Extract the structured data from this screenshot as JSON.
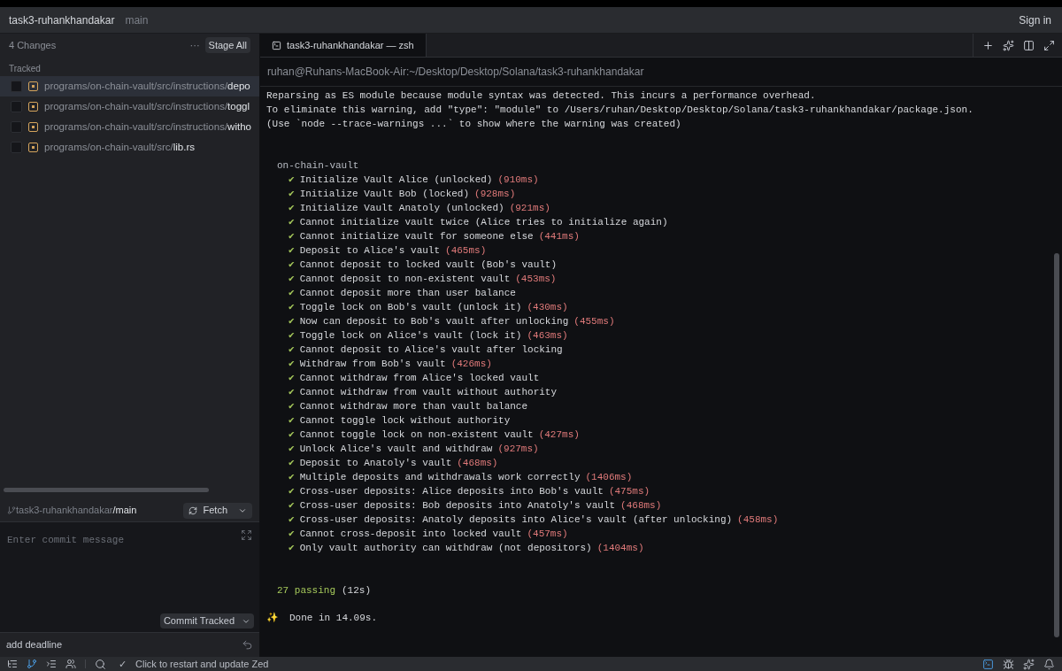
{
  "titlebar": {
    "project": "task3-ruhankhandakar",
    "branch": "main",
    "sign_in": "Sign in"
  },
  "git_panel": {
    "changes": "4 Changes",
    "more": "···",
    "stage_all": "Stage All",
    "section": "Tracked",
    "files": [
      {
        "dir": "programs/on-chain-vault/src/instructions/",
        "name": "depo",
        "checked": false,
        "selected": true
      },
      {
        "dir": "programs/on-chain-vault/src/instructions/",
        "name": "toggl",
        "checked": false,
        "selected": false
      },
      {
        "dir": "programs/on-chain-vault/src/instructions/",
        "name": "witho",
        "checked": false,
        "selected": false
      },
      {
        "dir": "programs/on-chain-vault/src/",
        "name": "lib.rs",
        "checked": false,
        "selected": false
      }
    ],
    "repo": "task3-ruhankhandakar",
    "repo_branch": "/main",
    "fetch": "Fetch",
    "commit_placeholder": "Enter commit message",
    "commit": "Commit Tracked",
    "last_commit": "add deadline"
  },
  "terminal": {
    "tab": "task3-ruhankhandakar — zsh",
    "path": "ruhan@Ruhans-MacBook-Air:~/Desktop/Desktop/Solana/task3-ruhankhandakar",
    "warnings": [
      "Reparsing as ES module because module syntax was detected. This incurs a performance overhead.",
      "To eliminate this warning, add \"type\": \"module\" to /Users/ruhan/Desktop/Desktop/Solana/task3-ruhankhandakar/package.json.",
      "(Use `node --trace-warnings ...` to show where the warning was created)"
    ],
    "suite": "on-chain-vault",
    "check": "✔",
    "tests": [
      {
        "name": "Initialize Vault Alice (unlocked)",
        "time": "(910ms)"
      },
      {
        "name": "Initialize Vault Bob (locked)",
        "time": "(928ms)"
      },
      {
        "name": "Initialize Vault Anatoly (unlocked)",
        "time": "(921ms)"
      },
      {
        "name": "Cannot initialize vault twice (Alice tries to initialize again)"
      },
      {
        "name": "Cannot initialize vault for someone else",
        "time": "(441ms)"
      },
      {
        "name": "Deposit to Alice's vault",
        "time": "(465ms)"
      },
      {
        "name": "Cannot deposit to locked vault (Bob's vault)"
      },
      {
        "name": "Cannot deposit to non-existent vault",
        "time": "(453ms)"
      },
      {
        "name": "Cannot deposit more than user balance"
      },
      {
        "name": "Toggle lock on Bob's vault (unlock it)",
        "time": "(430ms)"
      },
      {
        "name": "Now can deposit to Bob's vault after unlocking",
        "time": "(455ms)"
      },
      {
        "name": "Toggle lock on Alice's vault (lock it)",
        "time": "(463ms)"
      },
      {
        "name": "Cannot deposit to Alice's vault after locking"
      },
      {
        "name": "Withdraw from Bob's vault",
        "time": "(426ms)"
      },
      {
        "name": "Cannot withdraw from Alice's locked vault"
      },
      {
        "name": "Cannot withdraw from vault without authority"
      },
      {
        "name": "Cannot withdraw more than vault balance"
      },
      {
        "name": "Cannot toggle lock without authority"
      },
      {
        "name": "Cannot toggle lock on non-existent vault",
        "time": "(427ms)"
      },
      {
        "name": "Unlock Alice's vault and withdraw",
        "time": "(927ms)"
      },
      {
        "name": "Deposit to Anatoly's vault",
        "time": "(468ms)"
      },
      {
        "name": "Multiple deposits and withdrawals work correctly",
        "time": "(1406ms)"
      },
      {
        "name": "Cross-user deposits: Alice deposits into Bob's vault",
        "time": "(475ms)"
      },
      {
        "name": "Cross-user deposits: Bob deposits into Anatoly's vault",
        "time": "(468ms)"
      },
      {
        "name": "Cross-user deposits: Anatoly deposits into Alice's vault (after unlocking)",
        "time": "(458ms)"
      },
      {
        "name": "Cannot cross-deposit into locked vault",
        "time": "(457ms)"
      },
      {
        "name": "Only vault authority can withdraw (not depositors)",
        "time": "(1404ms)"
      }
    ],
    "passing": "27 passing",
    "duration": "(12s)",
    "sparkle": "✨",
    "done": "Done in 14.09s."
  },
  "status_bar": {
    "check": "✓",
    "message": "Click to restart and update Zed",
    "panels": [
      {
        "kind": "tree",
        "selected": false
      },
      {
        "kind": "git",
        "selected": true
      },
      {
        "kind": "outline",
        "selected": false
      },
      {
        "kind": "collab",
        "selected": false
      }
    ]
  }
}
